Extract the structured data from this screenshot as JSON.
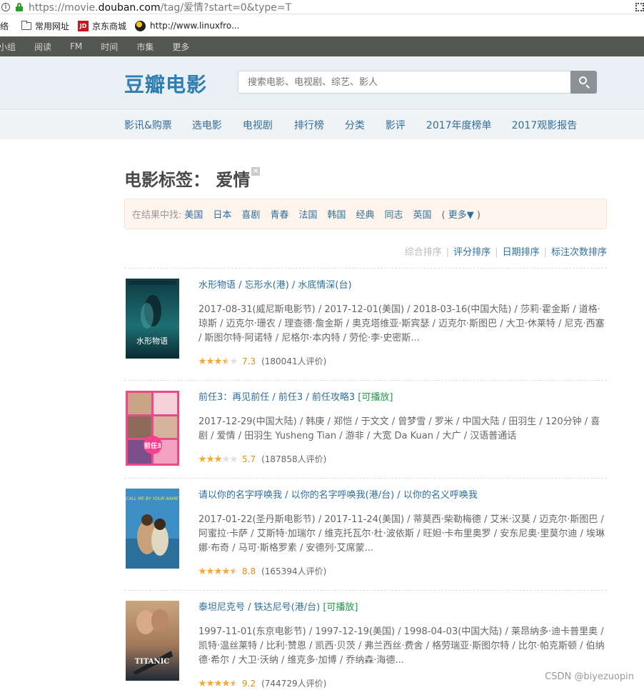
{
  "browser": {
    "url_prefix": "https://movie.",
    "url_domain": "douban.com",
    "url_suffix": "/tag/爱情?start=0&type=T",
    "bookmarks": [
      {
        "label": "络",
        "icon": "none"
      },
      {
        "label": "常用网址",
        "icon": "folder-icon"
      },
      {
        "label": "京东商城",
        "icon": "jd-icon"
      },
      {
        "label": "http://www.linuxfro...",
        "icon": "linux-icon"
      }
    ],
    "jd_icon_text": "JD"
  },
  "topnav": [
    "小组",
    "阅读",
    "FM",
    "时间",
    "市集",
    "更多"
  ],
  "header": {
    "logo": "豆瓣电影",
    "search_placeholder": "搜索电影、电视剧、综艺、影人"
  },
  "subnav": [
    "影讯&购票",
    "选电影",
    "电视剧",
    "排行榜",
    "分类",
    "影评",
    "2017年度榜单",
    "2017观影报告"
  ],
  "page": {
    "title": "电影标签：  爱情",
    "close_mark": "×"
  },
  "filter": {
    "label": "在结果中找:",
    "tags": [
      "美国",
      "日本",
      "喜剧",
      "青春",
      "法国",
      "韩国",
      "经典",
      "同志",
      "英国"
    ],
    "more_open": "(",
    "more": "更多▼",
    "more_close": ")"
  },
  "sort": {
    "current": "综合排序",
    "options": [
      "评分排序",
      "日期排序",
      "标注次数排序"
    ],
    "separator": "|"
  },
  "movies": [
    {
      "title": "水形物语 / 忘形水(港) / 水底情深(台)",
      "playable": "",
      "info": "2017-08-31(威尼斯电影节) / 2017-12-01(美国) / 2018-03-16(中国大陆) / 莎莉·霍金斯 / 道格·琼斯 / 迈克尔·珊农 / 理查德·詹金斯 / 奥克塔维亚·斯宾瑟 / 迈克尔·斯图巴 / 大卫·休莱特 / 尼克·西塞 / 斯图尔特·阿诺特 / 尼格尔·本内特 / 劳伦·李·史密斯...",
      "rating": 7.3,
      "score": "7.3",
      "votes": "(180041人评价)",
      "poster_text": "水形物语"
    },
    {
      "title": "前任3：再见前任 / 前任3 / 前任攻略3",
      "playable": "[可播放]",
      "info": "2017-12-29(中国大陆) / 韩庚 / 郑恺 / 于文文 / 曾梦雪 / 罗米 / 中国大陆 / 田羽生 / 120分钟 / 喜剧 / 爱情 / 田羽生 Yusheng Tian / 游非 / 大宽 Da Kuan / 大广 / 汉语普通话",
      "rating": 5.7,
      "score": "5.7",
      "votes": "(187858人评价)",
      "poster_text": "前任3"
    },
    {
      "title": "请以你的名字呼唤我 / 以你的名字呼唤我(港/台) / 以你的名义呼唤我",
      "playable": "",
      "info": "2017-01-22(圣丹斯电影节) / 2017-11-24(美国) / 蒂莫西·柴勒梅德 / 艾米·汉莫 / 迈克尔·斯图巴 / 阿蜜拉·卡萨 / 艾斯特·加瑞尔 / 维克托瓦尔·杜·波依斯 / 旺妲·卡布里奥罗 / 安东尼奥·里莫尔迪 / 埃琳娜·布奇 / 马可·斯格罗素 / 安德列·艾席蒙...",
      "rating": 8.8,
      "score": "8.8",
      "votes": "(165394人评价)",
      "poster_text": "CALL ME BY YOUR NAME"
    },
    {
      "title": "泰坦尼克号 / 铁达尼号(港/台)",
      "playable": "[可播放]",
      "info": "1997-11-01(东京电影节) / 1997-12-19(美国) / 1998-04-03(中国大陆) / 莱昂纳多·迪卡普里奥 / 凯特·温丝莱特 / 比利·赞恩 / 凯西·贝茨 / 弗兰西丝·费舍 / 格劳瑞亚·斯图尔特 / 比尔·帕克斯顿 / 伯纳德·希尔 / 大卫·沃纳 / 维克多·加博 / 乔纳森·海德...",
      "rating": 9.2,
      "score": "9.2",
      "votes": "(744729人评价)",
      "poster_text": "TITANIC"
    }
  ],
  "watermark": "CSDN @biyezuopin"
}
